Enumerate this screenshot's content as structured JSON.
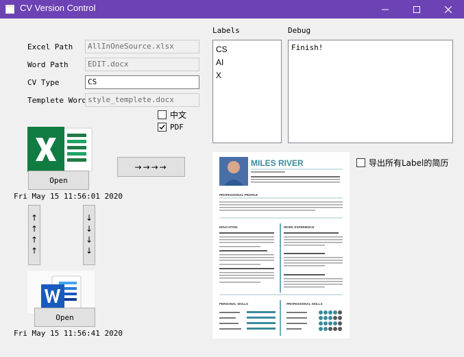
{
  "window": {
    "title": "CV Version Control"
  },
  "form": {
    "excel_label": "Excel Path",
    "excel_value": "AllInOneSource.xlsx",
    "word_label": "Word Path",
    "word_value": "EDIT.docx",
    "cvtype_label": "CV Type",
    "cvtype_value": "CS",
    "template_label": "Templete Word",
    "template_value": "style_templete.docx"
  },
  "options": {
    "chinese_label": "中文",
    "chinese_checked": false,
    "pdf_label": "PDF",
    "pdf_checked": true,
    "export_all_label": "导出所有Label的简历",
    "export_all_checked": false
  },
  "excel": {
    "open_label": "Open",
    "timestamp": "Fri May 15 11:56:01 2020"
  },
  "word": {
    "open_label": "Open",
    "timestamp": "Fri May 15 11:56:41 2020"
  },
  "arrows": {
    "right_label": "→→→→",
    "up_label": "↑↑↑↑",
    "down_label": "↓↓↓↓"
  },
  "labels": {
    "header": "Labels",
    "items": [
      "CS",
      "AI",
      "X"
    ]
  },
  "debug": {
    "header": "Debug",
    "text": "Finish!"
  },
  "resume_preview": {
    "name": "MILES RIVER",
    "profile_heading": "PROFESSIONAL PROFILE",
    "education_heading": "EDUCATION",
    "experience_heading": "WORK EXPERIENCE",
    "skills_heading": "PERSONAL SKILLS",
    "pro_skills_heading": "PROFESSIONAL SKILLS",
    "accent": "#3a8a9c"
  }
}
